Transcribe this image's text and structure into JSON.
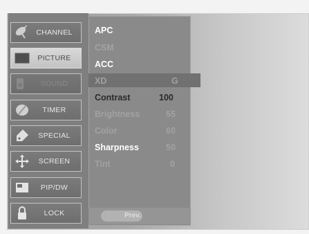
{
  "sidebar": {
    "items": [
      {
        "label": "CHANNEL",
        "icon": "satellite-icon"
      },
      {
        "label": "PICTURE",
        "icon": "picture-icon"
      },
      {
        "label": "SOUND",
        "icon": "speaker-icon"
      },
      {
        "label": "TIMER",
        "icon": "clock-icon"
      },
      {
        "label": "SPECIAL",
        "icon": "tag-icon"
      },
      {
        "label": "SCREEN",
        "icon": "move-arrows-icon"
      },
      {
        "label": "PIP/DW",
        "icon": "pip-icon"
      },
      {
        "label": "LOCK",
        "icon": "padlock-icon"
      }
    ],
    "selected": "PICTURE"
  },
  "submenu": {
    "apc": "APC",
    "csm": "CSM",
    "acc": "ACC",
    "xd": "XD",
    "xd_value": "G",
    "contrast_label": "Contrast",
    "contrast_value": "100",
    "brightness_label": "Brightness",
    "brightness_value": "55",
    "color_label": "Color",
    "color_value": "60",
    "sharpness_label": "Sharpness",
    "sharpness_value": "50",
    "tint_label": "Tint",
    "tint_value": "0"
  },
  "footer": {
    "prev_label": "Prev."
  }
}
